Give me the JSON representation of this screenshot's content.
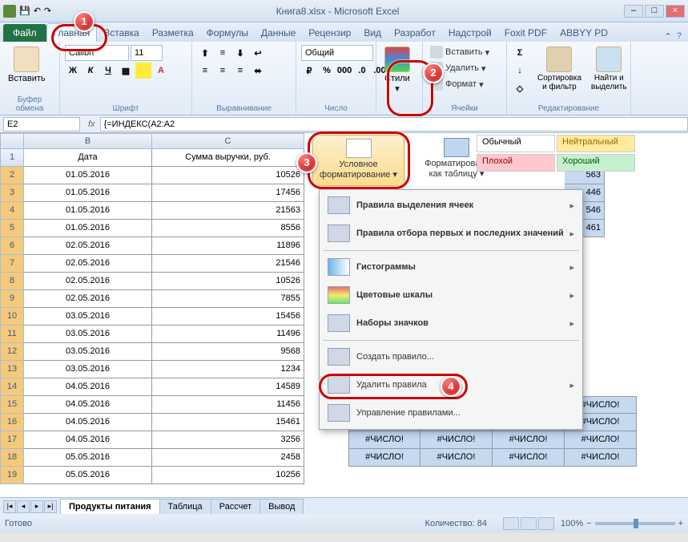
{
  "title": "Книга8.xlsx - Microsoft Excel",
  "tabs": {
    "file": "Файл",
    "home": "Главная",
    "insert": "Вставка",
    "layout": "Разметка",
    "formulas": "Формулы",
    "data": "Данные",
    "review": "Рецензир",
    "view": "Вид",
    "developer": "Разработ",
    "addins": "Надстрой",
    "foxit": "Foxit PDF",
    "abbyy": "ABBYY PD"
  },
  "ribbon_groups": {
    "clipboard": {
      "label": "Буфер обмена",
      "paste": "Вставить"
    },
    "font": {
      "label": "Шрифт",
      "name": "Calibri",
      "size": "11"
    },
    "alignment": {
      "label": "Выравнивание"
    },
    "number": {
      "label": "Число",
      "format": "Общий"
    },
    "styles": {
      "label": "Стили",
      "cf": "Условное форматирование",
      "fmt_table": "Форматировать как таблицу"
    },
    "cells": {
      "label": "Ячейки",
      "insert": "Вставить",
      "delete": "Удалить",
      "format": "Формат"
    },
    "editing": {
      "label": "Редактирование",
      "sort": "Сортировка и фильтр",
      "find": "Найти и выделить"
    }
  },
  "style_gallery": {
    "normal": "Обычный",
    "neutral": "Нейтральный",
    "bad": "Плохой",
    "good": "Хороший"
  },
  "name_box": "E2",
  "formula": "{=ИНДЕКС(A2:A2",
  "columns": {
    "B": "B",
    "C": "C"
  },
  "headers": {
    "date": "Дата",
    "sum": "Сумма выручки, руб."
  },
  "rows": [
    {
      "r": 1,
      "date": "Дата",
      "sum": "Сумма выручки, руб.",
      "hdr": true
    },
    {
      "r": 2,
      "date": "01.05.2016",
      "sum": "10526"
    },
    {
      "r": 3,
      "date": "01.05.2016",
      "sum": "17456"
    },
    {
      "r": 4,
      "date": "01.05.2016",
      "sum": "21563"
    },
    {
      "r": 5,
      "date": "01.05.2016",
      "sum": "8556"
    },
    {
      "r": 6,
      "date": "02.05.2016",
      "sum": "11896"
    },
    {
      "r": 7,
      "date": "02.05.2016",
      "sum": "21546"
    },
    {
      "r": 8,
      "date": "02.05.2016",
      "sum": "10526"
    },
    {
      "r": 9,
      "date": "02.05.2016",
      "sum": "7855"
    },
    {
      "r": 10,
      "date": "03.05.2016",
      "sum": "15456"
    },
    {
      "r": 11,
      "date": "03.05.2016",
      "sum": "11496"
    },
    {
      "r": 12,
      "date": "03.05.2016",
      "sum": "9568"
    },
    {
      "r": 13,
      "date": "03.05.2016",
      "sum": "1234"
    },
    {
      "r": 14,
      "date": "04.05.2016",
      "sum": "14589"
    },
    {
      "r": 15,
      "date": "04.05.2016",
      "sum": "11456"
    },
    {
      "r": 16,
      "date": "04.05.2016",
      "sum": "15461"
    },
    {
      "r": 17,
      "date": "04.05.2016",
      "sum": "3256"
    },
    {
      "r": 18,
      "date": "05.05.2016",
      "sum": "2458"
    },
    {
      "r": 19,
      "date": "05.05.2016",
      "sum": "10256"
    }
  ],
  "right_block": {
    "visible_values": [
      "563",
      "446",
      "546",
      "461"
    ],
    "error_text": "#ЧИСЛО!"
  },
  "cf_menu": {
    "highlight": "Правила выделения ячеек",
    "toprank": "Правила отбора первых и последних значений",
    "databars": "Гистограммы",
    "colorscales": "Цветовые шкалы",
    "iconsets": "Наборы значков",
    "newrule": "Создать правило...",
    "clear": "Удалить правила",
    "manage": "Управление правилами..."
  },
  "sheets": {
    "s1": "Продукты питания",
    "s2": "Таблица",
    "s3": "Рассчет",
    "s4": "Вывод"
  },
  "status": {
    "ready": "Готово",
    "count_label": "Количество:",
    "count": "84",
    "zoom": "100%"
  },
  "callouts": {
    "c1": "1",
    "c2": "2",
    "c3": "3",
    "c4": "4"
  }
}
